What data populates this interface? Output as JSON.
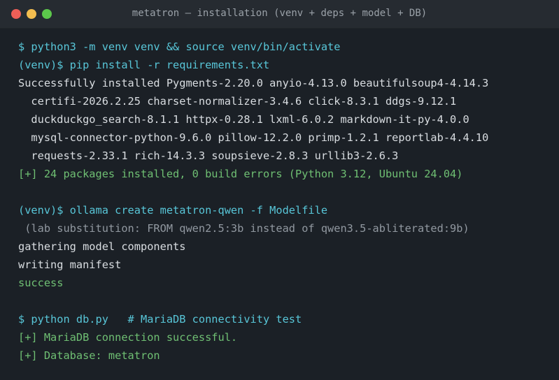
{
  "window": {
    "title": "metatron — installation (venv + deps + model + DB)"
  },
  "lines": [
    {
      "text": "$ python3 -m venv venv && source venv/bin/activate",
      "kind": "cmd"
    },
    {
      "text": "(venv)$ pip install -r requirements.txt",
      "kind": "cmd"
    },
    {
      "text": "Successfully installed Pygments-2.20.0 anyio-4.13.0 beautifulsoup4-4.14.3",
      "kind": "out"
    },
    {
      "text": "  certifi-2026.2.25 charset-normalizer-3.4.6 click-8.3.1 ddgs-9.12.1",
      "kind": "out"
    },
    {
      "text": "  duckduckgo_search-8.1.1 httpx-0.28.1 lxml-6.0.2 markdown-it-py-4.0.0",
      "kind": "out"
    },
    {
      "text": "  mysql-connector-python-9.6.0 pillow-12.2.0 primp-1.2.1 reportlab-4.4.10",
      "kind": "out"
    },
    {
      "text": "  requests-2.33.1 rich-14.3.3 soupsieve-2.8.3 urllib3-2.6.3",
      "kind": "out"
    },
    {
      "text": "[+] 24 packages installed, 0 build errors (Python 3.12, Ubuntu 24.04)",
      "kind": "ok"
    },
    {
      "text": "",
      "kind": "blank"
    },
    {
      "text": "(venv)$ ollama create metatron-qwen -f Modelfile",
      "kind": "cmd"
    },
    {
      "text": " (lab substitution: FROM qwen2.5:3b instead of qwen3.5-abliterated:9b)",
      "kind": "dim"
    },
    {
      "text": "gathering model components",
      "kind": "out"
    },
    {
      "text": "writing manifest",
      "kind": "out"
    },
    {
      "text": "success",
      "kind": "ok"
    },
    {
      "text": "",
      "kind": "blank"
    },
    {
      "text": "$ python db.py   # MariaDB connectivity test",
      "kind": "cmd"
    },
    {
      "text": "[+] MariaDB connection successful.",
      "kind": "ok"
    },
    {
      "text": "[+] Database: metatron",
      "kind": "ok"
    }
  ]
}
